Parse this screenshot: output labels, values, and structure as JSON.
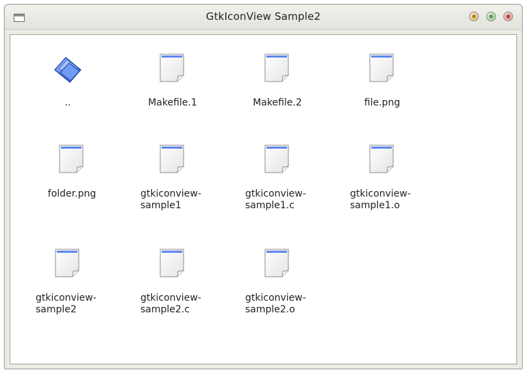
{
  "window": {
    "title": "GtkIconView Sample2"
  },
  "icons": {
    "folder": "folder-up-icon",
    "file": "document-icon"
  },
  "items": [
    {
      "label": "..",
      "type": "folder"
    },
    {
      "label": "Makefile.1",
      "type": "file"
    },
    {
      "label": "Makefile.2",
      "type": "file"
    },
    {
      "label": "file.png",
      "type": "file"
    },
    {
      "label": "folder.png",
      "type": "file"
    },
    {
      "label": "gtkiconview-\nsample1",
      "type": "file"
    },
    {
      "label": "gtkiconview-\nsample1.c",
      "type": "file"
    },
    {
      "label": "gtkiconview-\nsample1.o",
      "type": "file"
    },
    {
      "label": "gtkiconview-\nsample2",
      "type": "file"
    },
    {
      "label": "gtkiconview-\nsample2.c",
      "type": "file"
    },
    {
      "label": "gtkiconview-\nsample2.o",
      "type": "file"
    }
  ]
}
